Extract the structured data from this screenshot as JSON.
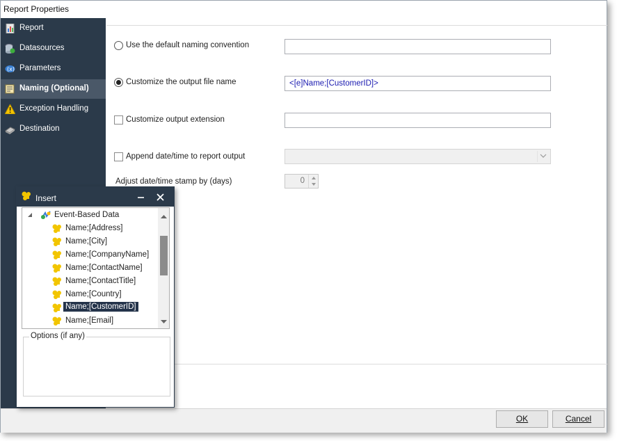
{
  "window": {
    "title": "Report Properties"
  },
  "sidebar": {
    "items": [
      {
        "label": "Report",
        "icon": "report-icon",
        "active": false
      },
      {
        "label": "Datasources",
        "icon": "datasources-icon",
        "active": false
      },
      {
        "label": "Parameters",
        "icon": "parameters-icon",
        "active": false
      },
      {
        "label": "Naming (Optional)",
        "icon": "naming-icon",
        "active": true
      },
      {
        "label": "Exception Handling",
        "icon": "warning-icon",
        "active": false
      },
      {
        "label": "Destination",
        "icon": "destination-icon",
        "active": false
      }
    ]
  },
  "naming": {
    "default_convention": {
      "label": "Use the default naming convention",
      "selected": false,
      "value": ""
    },
    "custom_name": {
      "label": "Customize the output file name",
      "selected": true,
      "value": "<[e]Name;[CustomerID]>"
    },
    "custom_extension": {
      "label": "Customize output extension",
      "checked": false,
      "value": ""
    },
    "append_datetime": {
      "label": "Append date/time to report output",
      "checked": false,
      "value": ""
    },
    "adjust_days": {
      "label": "Adjust date/time stamp by (days)",
      "value": "0"
    }
  },
  "insert_panel": {
    "title": "Insert",
    "root": "Event-Based Data",
    "items": [
      "Name;[Address]",
      "Name;[City]",
      "Name;[CompanyName]",
      "Name;[ContactName]",
      "Name;[ContactTitle]",
      "Name;[Country]",
      "Name;[CustomerID]",
      "Name;[Email]"
    ],
    "selected_index": 6,
    "options_label": "Options (if any)"
  },
  "footer": {
    "ok_label": "OK",
    "cancel_label": "Cancel"
  },
  "colors": {
    "sidebar": "#2b3a4a",
    "active_item": "#4a5868",
    "field_text": "#1a1ab0",
    "selection": "#24334a"
  }
}
